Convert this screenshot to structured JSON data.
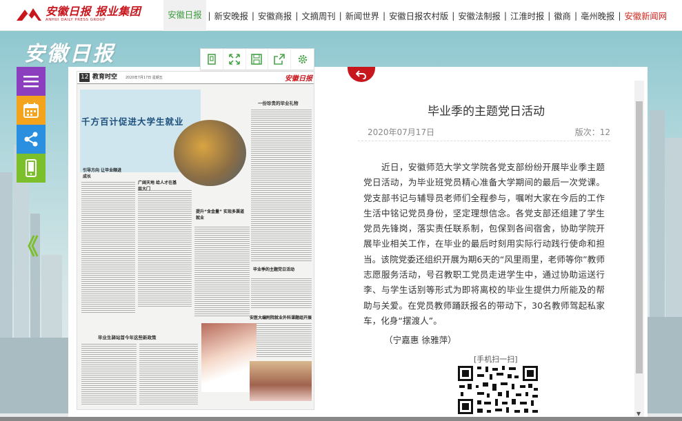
{
  "header": {
    "logo_cn": "安徽日报 报业集团",
    "logo_en": "ANHUI DAILY PRESS GROUP",
    "nav": [
      {
        "label": "安徽日报",
        "state": "active"
      },
      {
        "label": "新安晚报",
        "state": "normal"
      },
      {
        "label": "安徽商报",
        "state": "normal"
      },
      {
        "label": "文摘周刊",
        "state": "normal"
      },
      {
        "label": "新闻世界",
        "state": "normal"
      },
      {
        "label": "安徽日报农村版",
        "state": "normal"
      },
      {
        "label": "安徽法制报",
        "state": "normal"
      },
      {
        "label": "江淮时报",
        "state": "normal"
      },
      {
        "label": "徽商",
        "state": "normal"
      },
      {
        "label": "亳州晚报",
        "state": "normal"
      },
      {
        "label": "安徽新闻网",
        "state": "red"
      }
    ],
    "separator": "|"
  },
  "brand": "安徽日报",
  "sidebar": {
    "buttons": [
      {
        "icon": "menu-icon",
        "color": "#8b3fbf"
      },
      {
        "icon": "calendar-icon",
        "color": "#f4a31d"
      },
      {
        "icon": "share-icon",
        "color": "#2b8fe0"
      },
      {
        "icon": "mobile-icon",
        "color": "#7bbf2a"
      }
    ],
    "prev_label": "《"
  },
  "toolbar": {
    "buttons": [
      "single-page-icon",
      "fullscreen-icon",
      "save-icon",
      "export-icon",
      "settings-icon"
    ]
  },
  "newspaper": {
    "page_num": "12",
    "section": "教育时空",
    "date": "2020年7月17日 星期五",
    "brand": "安徽日报",
    "headline": "千方百计促进大学生就业",
    "right_title": "一份珍贵的毕业礼物",
    "grad_title": "毕业生驿站首今年这些新政策",
    "sub1": "引导方向 让毕业顺进成长",
    "sub2": "广阔天地 给人才在基层大门",
    "sub3": "提升“含金量” 实现多渠道就业",
    "sub4": "毕业季的主题党日活动",
    "sub5": "安医大编附院就业外科课题组开展"
  },
  "article": {
    "title": "毕业季的主题党日活动",
    "date": "2020年07月17日",
    "page": "版次：12",
    "body": "近日，安徽师范大学文学院各党支部纷纷开展毕业季主题党日活动，为毕业班党员精心准备大学期间的最后一次党课。党支部书记与辅导员老师们全程参与，嘱咐大家在今后的工作生活中铭记党员身份，坚定理想信念。各党支部还组建了学生党员先锋岗，落实责任联系制，包保到各间宿舍，协助学院开展毕业相关工作，在毕业的最后时刻用实际行动践行使命和担当。该院党委还组织开展为期6天的“风里雨里，老师等你”教师志愿服务活动，号召教职工党员走进学生中，通过协助运送行李、与学生话别等形式为即将离校的毕业生提供力所能及的帮助与关爱。在党员教师踊跃报名的带动下，30名教师驾起私家车，化身“摆渡人”。",
    "author": "（宁嘉惠  徐雅萍）",
    "qr_label": "[手机扫一扫]"
  },
  "colors": {
    "accent_red": "#c8161d",
    "nav_active": "#3c9a3c",
    "headline_blue": "#1d4f7c"
  }
}
